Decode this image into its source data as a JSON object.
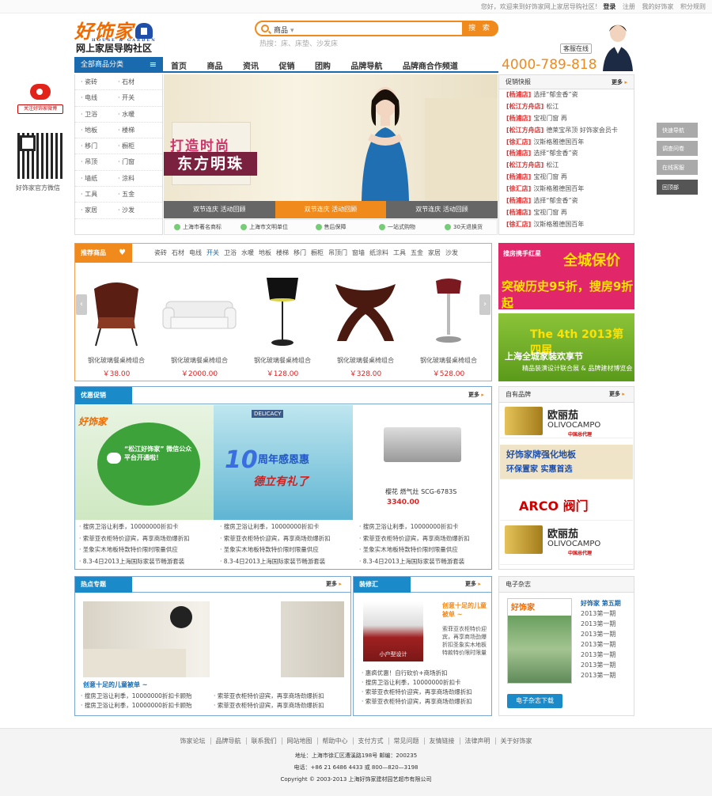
{
  "topbar": {
    "welcome": "您好，欢迎来到好饰家网上家居导购社区！",
    "login": "登录",
    "register": "注册",
    "my_account": "我的好饰家",
    "points": "积分规则"
  },
  "header": {
    "logo_text": "好饰家",
    "logo_sub": "HOUSE & GARDEN",
    "slogan": "网上家居导购社区",
    "search_scope": "商品",
    "search_button": "搜 索",
    "hot_terms": "热搜：床、床垫、沙发床",
    "service_online": "客服在线",
    "phone": "4000-789-818"
  },
  "nav": {
    "all_categories": "全部商品分类",
    "items": [
      "首页",
      "商品",
      "资讯",
      "促销",
      "团购",
      "品牌导航",
      "品牌商合作频道"
    ]
  },
  "social": {
    "weibo_label": "关注好饰家微博",
    "wechat_label": "好饰家官方微信"
  },
  "categories": [
    [
      "瓷砖",
      "石材"
    ],
    [
      "电线",
      "开关"
    ],
    [
      "卫浴",
      "水暖"
    ],
    [
      "地板",
      "楼梯"
    ],
    [
      "移门",
      "橱柜"
    ],
    [
      "吊顶",
      "门窗"
    ],
    [
      "墙纸",
      "涂料"
    ],
    [
      "工具",
      "五金"
    ],
    [
      "家居",
      "沙发"
    ]
  ],
  "banner": {
    "line1": "打造时尚",
    "line2": "东方明珠",
    "tabs": [
      "双节连庆  活动回顾",
      "双节连庆  活动回顾",
      "双节连庆  活动回顾"
    ],
    "badges": [
      "上海市著名商标",
      "上海市文明单位",
      "售后保障",
      "一站式购物",
      "30天退换货"
    ]
  },
  "promo": {
    "title": "促销快报",
    "more": "更多",
    "items": [
      {
        "tag": "[杨浦店]",
        "text": "选择“郁金香”瓷"
      },
      {
        "tag": "[松江方舟店]",
        "text": "松江"
      },
      {
        "tag": "[杨浦店]",
        "text": "宝视门窗 再"
      },
      {
        "tag": "[松江方舟店]",
        "text": "德莱宝吊顶 好饰家会员卡"
      },
      {
        "tag": "[徐汇店]",
        "text": "汉斯格雅德国百年"
      },
      {
        "tag": "[杨浦店]",
        "text": "选择“郁金香”瓷"
      },
      {
        "tag": "[松江方舟店]",
        "text": "松江"
      },
      {
        "tag": "[杨浦店]",
        "text": "宝视门窗 再"
      },
      {
        "tag": "[徐汇店]",
        "text": "汉斯格雅德国百年"
      },
      {
        "tag": "[杨浦店]",
        "text": "选择“郁金香”瓷"
      },
      {
        "tag": "[杨浦店]",
        "text": "宝视门窗 再"
      },
      {
        "tag": "[徐汇店]",
        "text": "汉斯格雅德国百年"
      }
    ]
  },
  "sidetools": [
    "快速导航",
    "调查问卷",
    "在线客服",
    "回顶部"
  ],
  "recommend": {
    "title": "推荐商品",
    "cats": [
      "瓷砖",
      "石材",
      "电线",
      "开关",
      "卫浴",
      "水暖",
      "地板",
      "楼梯",
      "移门",
      "橱柜",
      "吊顶门",
      "窗墙",
      "纸涂料",
      "工具",
      "五金",
      "家居",
      "沙发"
    ],
    "products": [
      {
        "name": "钢化玻璃餐桌椅组合",
        "price": "￥38.00"
      },
      {
        "name": "钢化玻璃餐桌椅组合",
        "price": "￥2000.00"
      },
      {
        "name": "钢化玻璃餐桌椅组合",
        "price": "￥128.00"
      },
      {
        "name": "钢化玻璃餐桌椅组合",
        "price": "￥328.00"
      },
      {
        "name": "钢化玻璃餐桌椅组合",
        "price": "￥528.00"
      }
    ]
  },
  "ads": {
    "ad1_a": "搜房携手红星",
    "ad1_b": "全城保价",
    "ad1_c": "突破历史95折，搜房9折起",
    "ad2_a": "The 4th  2013第四届",
    "ad2_b": "上海全城家装欢享节",
    "ad2_c": "精品装潢设计联合展 & 品牌建材博览会"
  },
  "discount": {
    "title": "优惠促销",
    "more": "更多",
    "d1_logo": "好饰家",
    "d1_text": "“松江好饰家” 微信公众平台开通啦！",
    "d2_delicacy": "DELICACY",
    "d2_num": "10",
    "d2_title": "周年感恩惠",
    "d2_sub": "德立有礼了",
    "d3_name": "樱花 燃气灶 SCG-6783S",
    "d3_price": "3340.00",
    "list": [
      "搜房卫浴让利季，10000000折扣卡",
      "索菲亚衣柜特价迎宾，再享商场劲爆折扣",
      "圣象实木地板特款特价限时限量供应",
      "8.3-4日2013上海国际家装节畅游套装"
    ]
  },
  "brands": {
    "title": "自有品牌",
    "more": "更多",
    "b1_t": "欧丽茄",
    "b1_s": "OLIVOCAMPO",
    "b1_c": "中国总代理",
    "b2_t": "好饰家牌强化地板",
    "b2_s": "环保置家    实惠首选",
    "b3_t": "ARCO 阀门",
    "b4_t": "欧丽茄",
    "b4_s": "OLIVOCAMPO",
    "b4_c": "中国总代理"
  },
  "hot": {
    "title": "热点专题",
    "more": "更多",
    "caption": "创意十足的儿童被单 ~",
    "list_left": [
      "搜房卫浴让利季，10000000折扣卡顾殆",
      "搜房卫浴让利季，10000000折扣卡顾殆"
    ],
    "list_right": [
      "索菲亚衣柜特价迎宾，再享商场劲爆折扣",
      "索菲亚衣柜特价迎宾，再享商场劲爆折扣"
    ]
  },
  "deco": {
    "title": "装修汇",
    "more": "更多",
    "img_caption": "小户型设计",
    "headline": "创意十足的儿童被单 ~",
    "text": "索菲亚衣柜特价迎宾，再享商场劲爆折扣圣象实木地板特款特价限时限量",
    "list": [
      "惠疯优惠！自行砍价+商场折扣",
      "搜房卫浴让利季，10000000折扣卡",
      "索菲亚衣柜特价迎宾，再享商场劲爆折扣",
      "索菲亚衣柜特价迎宾，再享商场劲爆折扣"
    ]
  },
  "magazine": {
    "title": "电子杂志",
    "cover_title": "好饰家",
    "issue_head": "好饰家 第五期",
    "issues": [
      "2013第一期",
      "2013第一期",
      "2013第一期",
      "2013第一期",
      "2013第一期",
      "2013第一期",
      "2013第一期"
    ],
    "download": "电子杂志下载"
  },
  "footer": {
    "links": [
      "饰家论坛",
      "品牌导航",
      "联系我们",
      "网站地图",
      "帮助中心",
      "支付方式",
      "常见问题",
      "友情链接",
      "法律声明",
      "关于好饰家"
    ],
    "address": "地址：上海市徐汇区漕溪路198号  邮编：200235",
    "tel": "电话：+86 21 6486 4433 或 800—820—3198",
    "copyright": "Copyright © 2003-2013 上海好饰家建材园艺超市有限公司"
  }
}
